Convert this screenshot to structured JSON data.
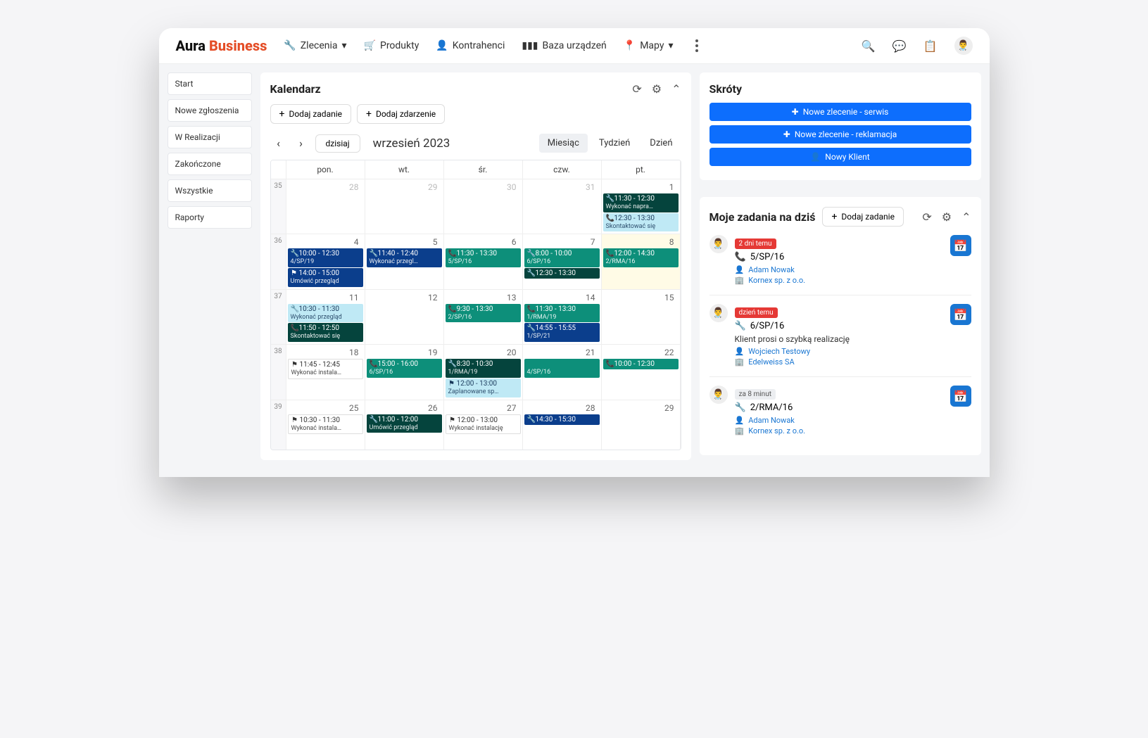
{
  "brand": {
    "a": "Aura",
    "b": "Business"
  },
  "nav": {
    "zlecenia": "Zlecenia",
    "produkty": "Produkty",
    "kontrahenci": "Kontrahenci",
    "baza": "Baza urządzeń",
    "mapy": "Mapy"
  },
  "sidebar": [
    "Start",
    "Nowe zgłoszenia",
    "W Realizacji",
    "Zakończone",
    "Wszystkie",
    "Raporty"
  ],
  "calendar": {
    "title": "Kalendarz",
    "addTask": "Dodaj zadanie",
    "addEvent": "Dodaj zdarzenie",
    "today": "dzisiaj",
    "month": "wrzesień 2023",
    "views": [
      "Miesiąc",
      "Tydzień",
      "Dzień"
    ],
    "dow": [
      "pon.",
      "wt.",
      "śr.",
      "czw.",
      "pt."
    ],
    "weeks": [
      {
        "num": "35",
        "days": [
          {
            "n": "28",
            "out": true,
            "events": []
          },
          {
            "n": "29",
            "out": true,
            "events": []
          },
          {
            "n": "30",
            "out": true,
            "events": []
          },
          {
            "n": "31",
            "out": true,
            "events": []
          },
          {
            "n": "1",
            "events": [
              {
                "c": "darkteal",
                "ico": "🔧",
                "t": "11:30 - 12:30",
                "s": "Wykonać napra…"
              },
              {
                "c": "cyan",
                "ico": "📞",
                "t": "12:30 - 13:30",
                "s": "Skontaktować się"
              }
            ]
          }
        ]
      },
      {
        "num": "36",
        "days": [
          {
            "n": "4",
            "events": [
              {
                "c": "navy",
                "ico": "🔧",
                "t": "10:00 - 12:30",
                "s": "4/SP/19"
              },
              {
                "c": "navy",
                "ico": "⚑",
                "t": "14:00 - 15:00",
                "s": "Umówić przegląd"
              }
            ]
          },
          {
            "n": "5",
            "events": [
              {
                "c": "navy",
                "ico": "🔧",
                "t": "11:40 - 12:40",
                "s": "Wykonać przegl…"
              }
            ]
          },
          {
            "n": "6",
            "events": [
              {
                "c": "teal",
                "ico": "📞",
                "t": "11:30 - 13:30",
                "s": "5/SP/16"
              }
            ]
          },
          {
            "n": "7",
            "events": [
              {
                "c": "teal",
                "ico": "🔧",
                "t": "8:00 - 10:00",
                "s": "6/SP/16"
              },
              {
                "c": "darkteal",
                "ico": "🔧",
                "t": "12:30 - 13:30",
                "s": ""
              }
            ]
          },
          {
            "n": "8",
            "today": true,
            "events": [
              {
                "c": "teal",
                "ico": "📞",
                "t": "12:00 - 14:30",
                "s": "2/RMA/16"
              }
            ]
          }
        ]
      },
      {
        "num": "37",
        "days": [
          {
            "n": "11",
            "events": [
              {
                "c": "cyan",
                "ico": "🔧",
                "t": "10:30 - 11:30",
                "s": "Wykonać przegląd"
              },
              {
                "c": "darkteal",
                "ico": "📞",
                "t": "11:50 - 12:50",
                "s": "Skontaktować się"
              }
            ]
          },
          {
            "n": "12",
            "events": []
          },
          {
            "n": "13",
            "events": [
              {
                "c": "teal",
                "ico": "📞",
                "t": "9:30 - 13:30",
                "s": "2/SP/16"
              }
            ]
          },
          {
            "n": "14",
            "events": [
              {
                "c": "teal",
                "ico": "📞",
                "t": "11:30 - 13:30",
                "s": "1/RMA/19"
              },
              {
                "c": "navy",
                "ico": "🔧",
                "t": "14:55 - 15:55",
                "s": "1/SP/21"
              }
            ]
          },
          {
            "n": "15",
            "events": []
          }
        ]
      },
      {
        "num": "38",
        "days": [
          {
            "n": "18",
            "events": [
              {
                "c": "white",
                "ico": "⚑",
                "t": "11:45 - 12:45",
                "s": "Wykonać instala…"
              }
            ]
          },
          {
            "n": "19",
            "events": [
              {
                "c": "teal",
                "ico": "📞",
                "t": "15:00 - 16:00",
                "s": "6/SP/16"
              }
            ]
          },
          {
            "n": "20",
            "events": [
              {
                "c": "darkteal",
                "ico": "🔧",
                "t": "8:30 - 10:30",
                "s": "1/RMA/19"
              },
              {
                "c": "cyan",
                "ico": "⚑",
                "t": "12:00 - 13:00",
                "s": "Zaplanowane sp…"
              }
            ]
          },
          {
            "n": "21",
            "events": [
              {
                "c": "teal",
                "ico": "",
                "t": "",
                "s": "4/SP/16"
              }
            ]
          },
          {
            "n": "22",
            "events": [
              {
                "c": "teal",
                "ico": "📞",
                "t": "10:00 - 12:30",
                "s": ""
              }
            ]
          }
        ]
      },
      {
        "num": "39",
        "days": [
          {
            "n": "25",
            "events": [
              {
                "c": "white",
                "ico": "⚑",
                "t": "10:30 - 11:30",
                "s": "Wykonać instala…"
              }
            ]
          },
          {
            "n": "26",
            "events": [
              {
                "c": "darkteal",
                "ico": "🔧",
                "t": "11:00 - 12:00",
                "s": "Umówić przegląd"
              }
            ]
          },
          {
            "n": "27",
            "events": [
              {
                "c": "white",
                "ico": "⚑",
                "t": "12:00 - 13:00",
                "s": "Wykonać instalację"
              }
            ]
          },
          {
            "n": "28",
            "events": [
              {
                "c": "navy",
                "ico": "🔧",
                "t": "14:30 - 15:30",
                "s": ""
              }
            ]
          },
          {
            "n": "29",
            "events": []
          }
        ]
      }
    ]
  },
  "shortcuts": {
    "title": "Skróty",
    "items": [
      "Nowe zlecenie - serwis",
      "Nowe zlecenie - reklamacja",
      "Nowy Klient"
    ]
  },
  "mytasks": {
    "title": "Moje zadania na dziś",
    "addTask": "Dodaj zadanie",
    "items": [
      {
        "tag": "2 dni temu",
        "tagClass": "red",
        "ico": "📞",
        "id": "5/SP/16",
        "note": "",
        "person": "Adam Nowak",
        "company": "Kornex sp. z o.o."
      },
      {
        "tag": "dzień temu",
        "tagClass": "red",
        "ico": "🔧",
        "id": "6/SP/16",
        "note": "Klient prosi o szybką realizację",
        "person": "Wojciech Testowy",
        "company": "Edelweiss SA"
      },
      {
        "tag": "za 8 minut",
        "tagClass": "gray",
        "ico": "🔧",
        "id": "2/RMA/16",
        "note": "",
        "person": "Adam Nowak",
        "company": "Kornex sp. z o.o."
      }
    ]
  }
}
